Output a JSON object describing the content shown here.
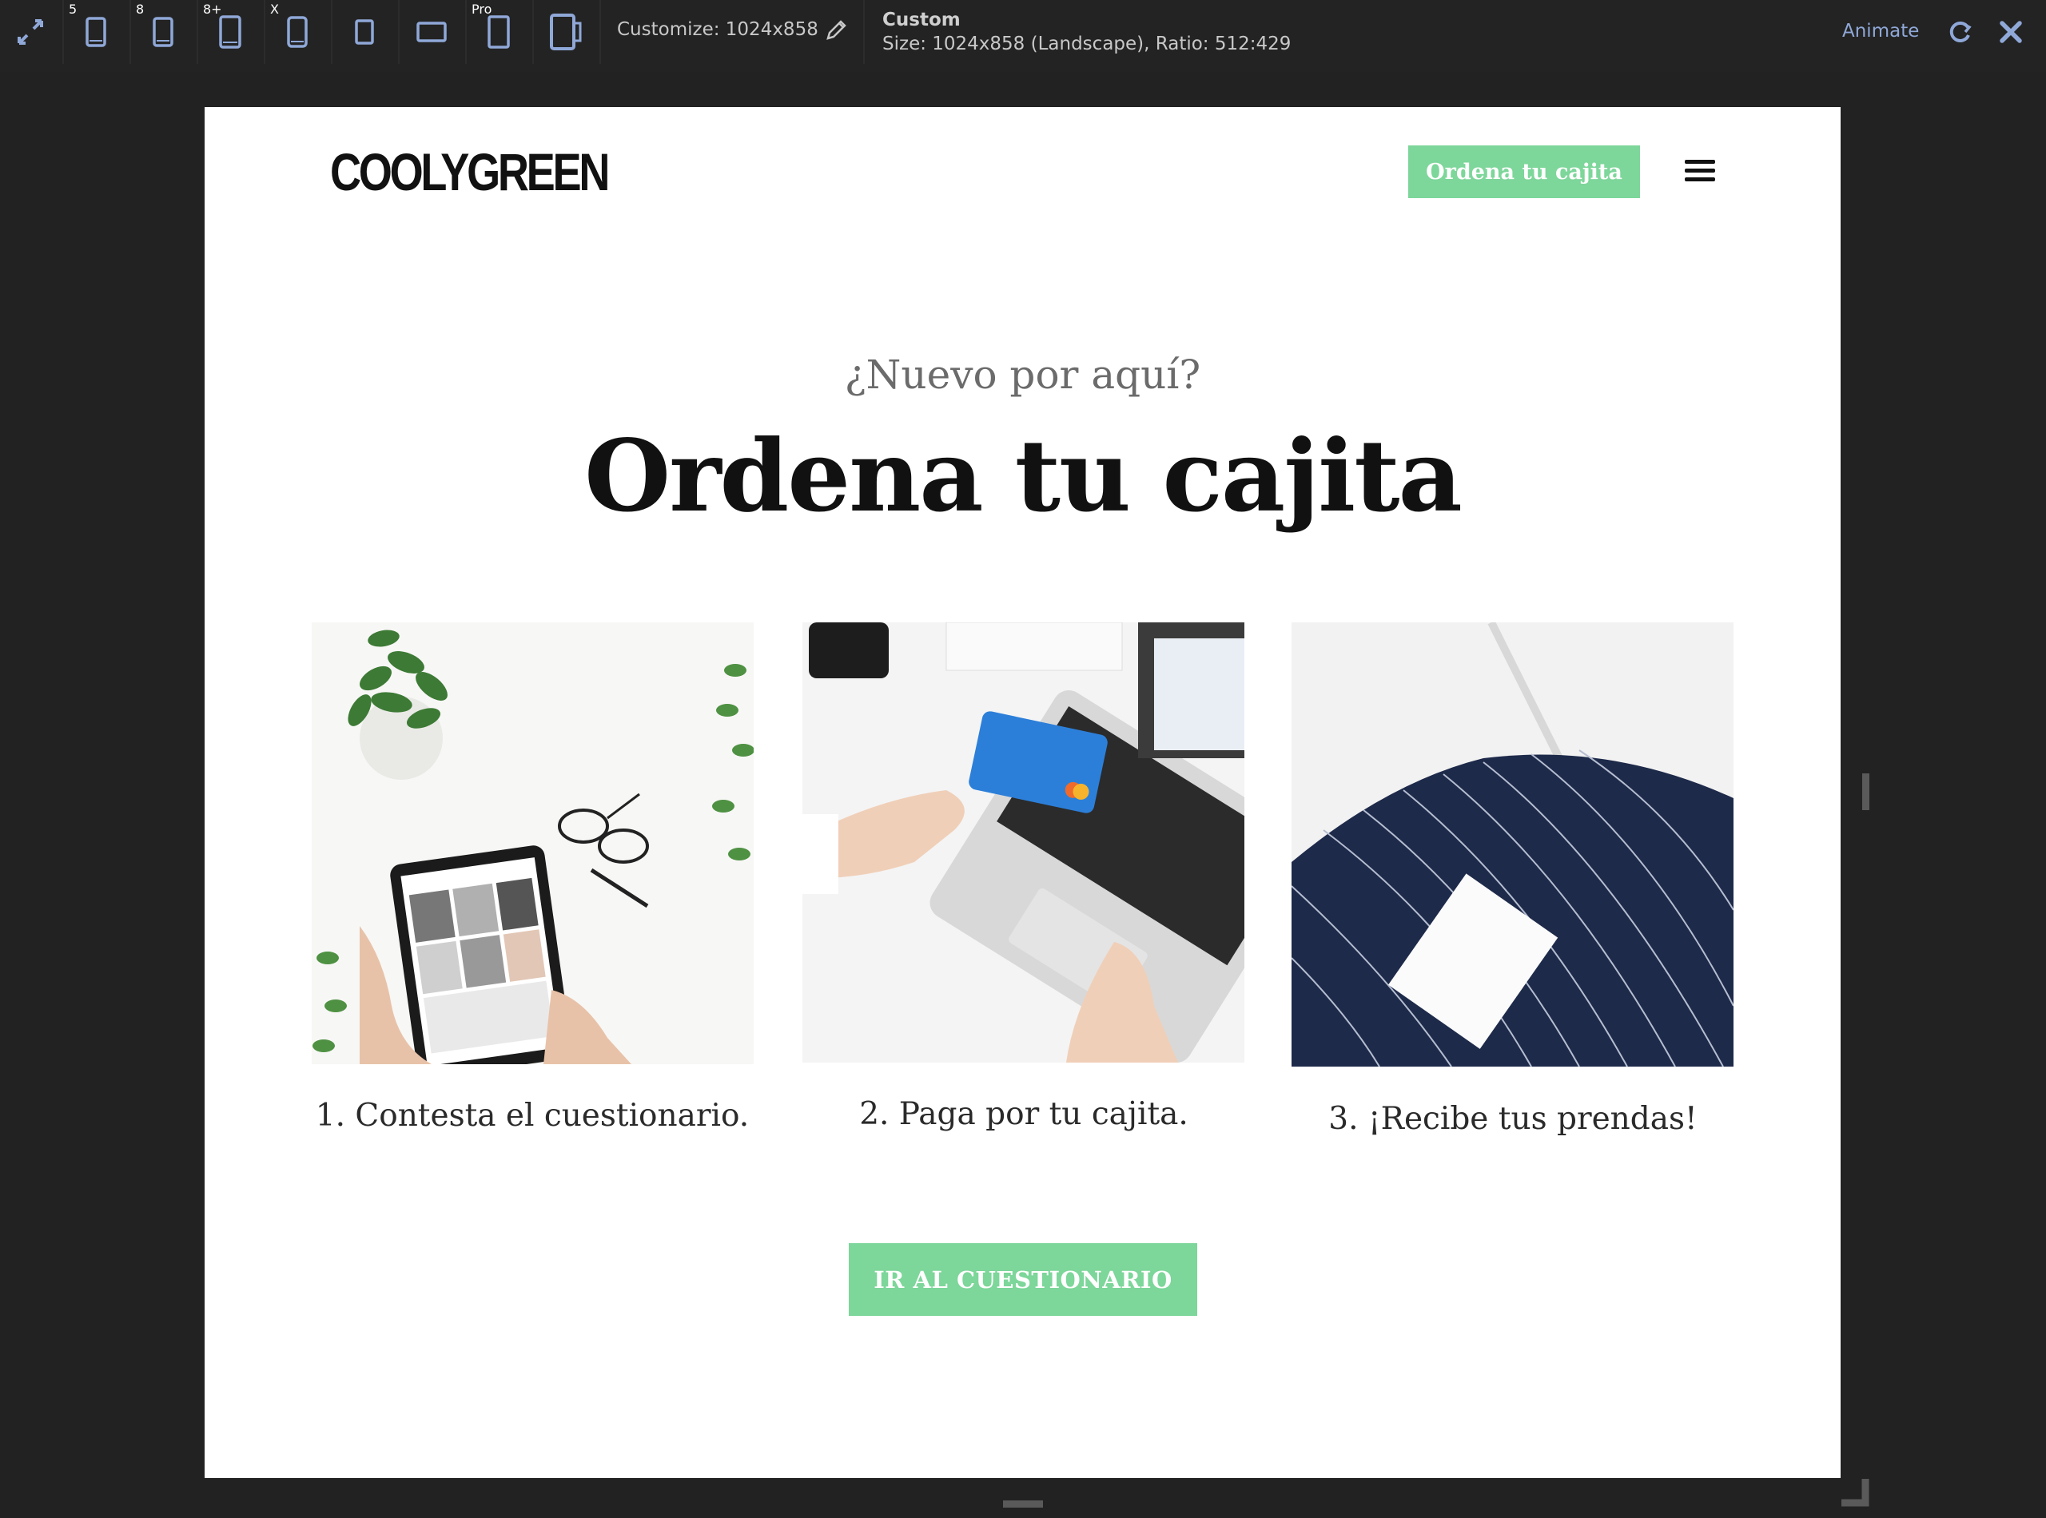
{
  "toolbar": {
    "devices": [
      {
        "label": "5",
        "name": "iphone-5"
      },
      {
        "label": "8",
        "name": "iphone-8"
      },
      {
        "label": "8+",
        "name": "iphone-8-plus"
      },
      {
        "label": "X",
        "name": "iphone-x"
      },
      {
        "label": "",
        "name": "ipad"
      },
      {
        "label": "",
        "name": "ipad-landscape"
      },
      {
        "label": "Pro",
        "name": "ipad-pro"
      },
      {
        "label": "",
        "name": "custom-device"
      }
    ],
    "customize_label": "Customize: 1024x858",
    "info_title": "Custom",
    "info_size": "Size: 1024x858 (Landscape), Ratio: 512:429",
    "animate_label": "Animate",
    "accent_color": "#8fa8d8"
  },
  "site": {
    "logo": "COOLYGREEN",
    "nav_cta": "Ordena tu cajita",
    "eyebrow": "¿Nuevo por aquí?",
    "headline": "Ordena tu cajita",
    "steps": [
      {
        "label": "1. Contesta el cuestionario.",
        "image": "tablet-shopping-photo"
      },
      {
        "label": "2. Paga por tu cajita.",
        "image": "credit-card-laptop-photo"
      },
      {
        "label": "3. ¡Recibe tus prendas!",
        "image": "clothing-box-photo"
      }
    ],
    "main_cta": "IR AL CUESTIONARIO",
    "brand_green": "#7dd69a"
  }
}
